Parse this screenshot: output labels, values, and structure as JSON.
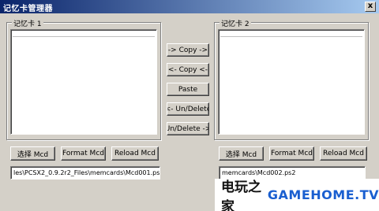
{
  "window": {
    "title": "记忆卡管理器",
    "close_glyph": "x"
  },
  "left_panel": {
    "label": "记忆卡 1",
    "buttons": {
      "select": "选择 Mcd",
      "format": "Format Mcd",
      "reload": "Reload Mcd"
    },
    "path": "les\\PCSX2_0.9.2r2_Files\\memcards\\Mcd001.ps2"
  },
  "right_panel": {
    "label": "记忆卡 2",
    "buttons": {
      "select": "选择 Mcd",
      "format": "Format Mcd",
      "reload": "Reload Mcd"
    },
    "path": "memcards\\Mcd002.ps2"
  },
  "center_buttons": {
    "copy_right": "-> Copy ->",
    "copy_left": "<- Copy <-",
    "paste": "Paste",
    "undelete_left": "<- Un/Delete",
    "undelete_right": "Un/Delete ->"
  },
  "watermark": {
    "cn": "电玩之家",
    "en": "GAMEHOME.TV"
  }
}
